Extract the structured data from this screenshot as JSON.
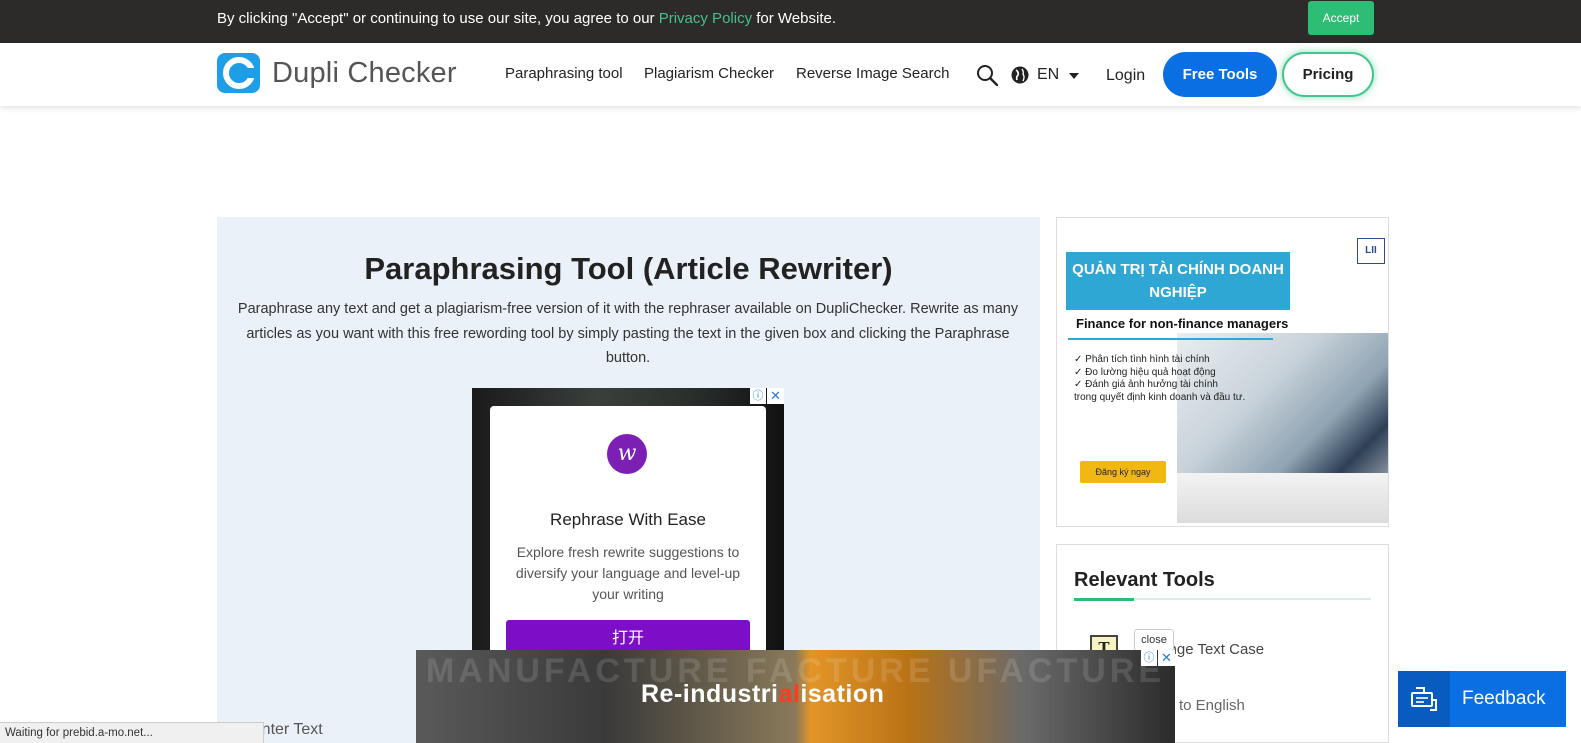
{
  "cookie_bar": {
    "text_before": "By clicking \"Accept\" or continuing to use our site, you agree to our ",
    "link": "Privacy Policy",
    "text_after": " for Website.",
    "accept_label": "Accept"
  },
  "header": {
    "logo_text": "Dupli Checker",
    "nav": [
      "Paraphrasing tool",
      "Plagiarism Checker",
      "Reverse Image Search"
    ],
    "language": "EN",
    "login": "Login",
    "free_tools": "Free Tools",
    "pricing": "Pricing"
  },
  "main": {
    "title": "Paraphrasing Tool (Article Rewriter)",
    "description": "Paraphrase any text and get a plagiarism-free version of it with the rephraser available on DupliChecker. Rewrite as many articles as you want with this free rewording tool by simply pasting the text in the given box and clicking the Paraphrase button.",
    "enter_text": "Enter Text"
  },
  "ad_center": {
    "logo_letter": "w",
    "headline": "Rephrase With Ease",
    "body": "Explore fresh rewrite suggestions to diversify your language and level-up your writing",
    "cta": "打开",
    "info": "ⓘ",
    "close": "✕"
  },
  "ad_right": {
    "banner": "QUẢN TRỊ TÀI CHÍNH DOANH NGHIỆP",
    "subtitle": "Finance for non-finance managers",
    "bullets": [
      "✓ Phân tích tình hình tài chính",
      "✓ Đo lường hiệu quả hoạt động",
      "✓ Đánh giá ảnh hưởng tài chính",
      "trong quyết định kinh doanh và đầu tư."
    ],
    "register": "Đăng ký ngay",
    "brand": "LII"
  },
  "relevant_tools": {
    "title": "Relevant Tools",
    "items": [
      "Change Text Case",
      "to English"
    ],
    "close_tip": "close"
  },
  "ad_bottom": {
    "watermark": "MANUFACTURE  FACTURE  UFACTURE",
    "headline_a": "Re-industri",
    "headline_b": "al",
    "headline_c": "isation",
    "info": "ⓘ",
    "close": "✕"
  },
  "feedback": {
    "label": "Feedback"
  },
  "status_bar": {
    "text": "Waiting for prebid.a-mo.net..."
  },
  "colors": {
    "brand_blue": "#0a6fe3",
    "accent_green": "#2ebd74",
    "panel_bg": "#eaf1f8",
    "ad_purple": "#7c0ec7"
  }
}
